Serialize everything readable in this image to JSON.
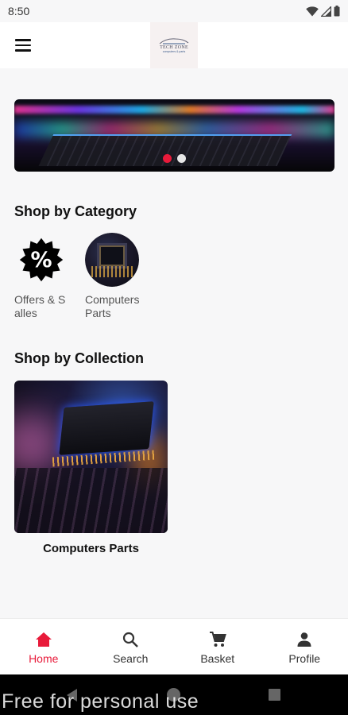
{
  "status_bar": {
    "time": "8:50",
    "icons": [
      "wifi-icon",
      "signal-icon",
      "battery-icon"
    ]
  },
  "header": {
    "menu_icon": "hamburger-menu-icon",
    "logo_text": "TECH ZONE",
    "logo_subtext": "computers & parts"
  },
  "banner": {
    "slide_count": 2,
    "active_slide": 1,
    "active_dot_color": "#e81a3a",
    "inactive_dot_color": "#e6e6e6"
  },
  "categories": {
    "title": "Shop by Category",
    "items": [
      {
        "label": "Offers & Salles",
        "icon": "percent-badge-icon"
      },
      {
        "label": "Computers Parts",
        "icon": "circuit-chip-image"
      }
    ]
  },
  "collections": {
    "title": "Shop by Collection",
    "items": [
      {
        "label": "Computers Parts"
      }
    ]
  },
  "bottom_nav": {
    "accent_color": "#e81a3a",
    "items": [
      {
        "label": "Home",
        "icon": "home-icon",
        "active": true
      },
      {
        "label": "Search",
        "icon": "search-icon",
        "active": false
      },
      {
        "label": "Basket",
        "icon": "cart-icon",
        "active": false
      },
      {
        "label": "Profile",
        "icon": "person-icon",
        "active": false
      }
    ]
  },
  "system_nav": {
    "buttons": [
      "back-icon",
      "home-circle-icon",
      "recents-icon"
    ]
  },
  "watermark": "Free for personal use"
}
